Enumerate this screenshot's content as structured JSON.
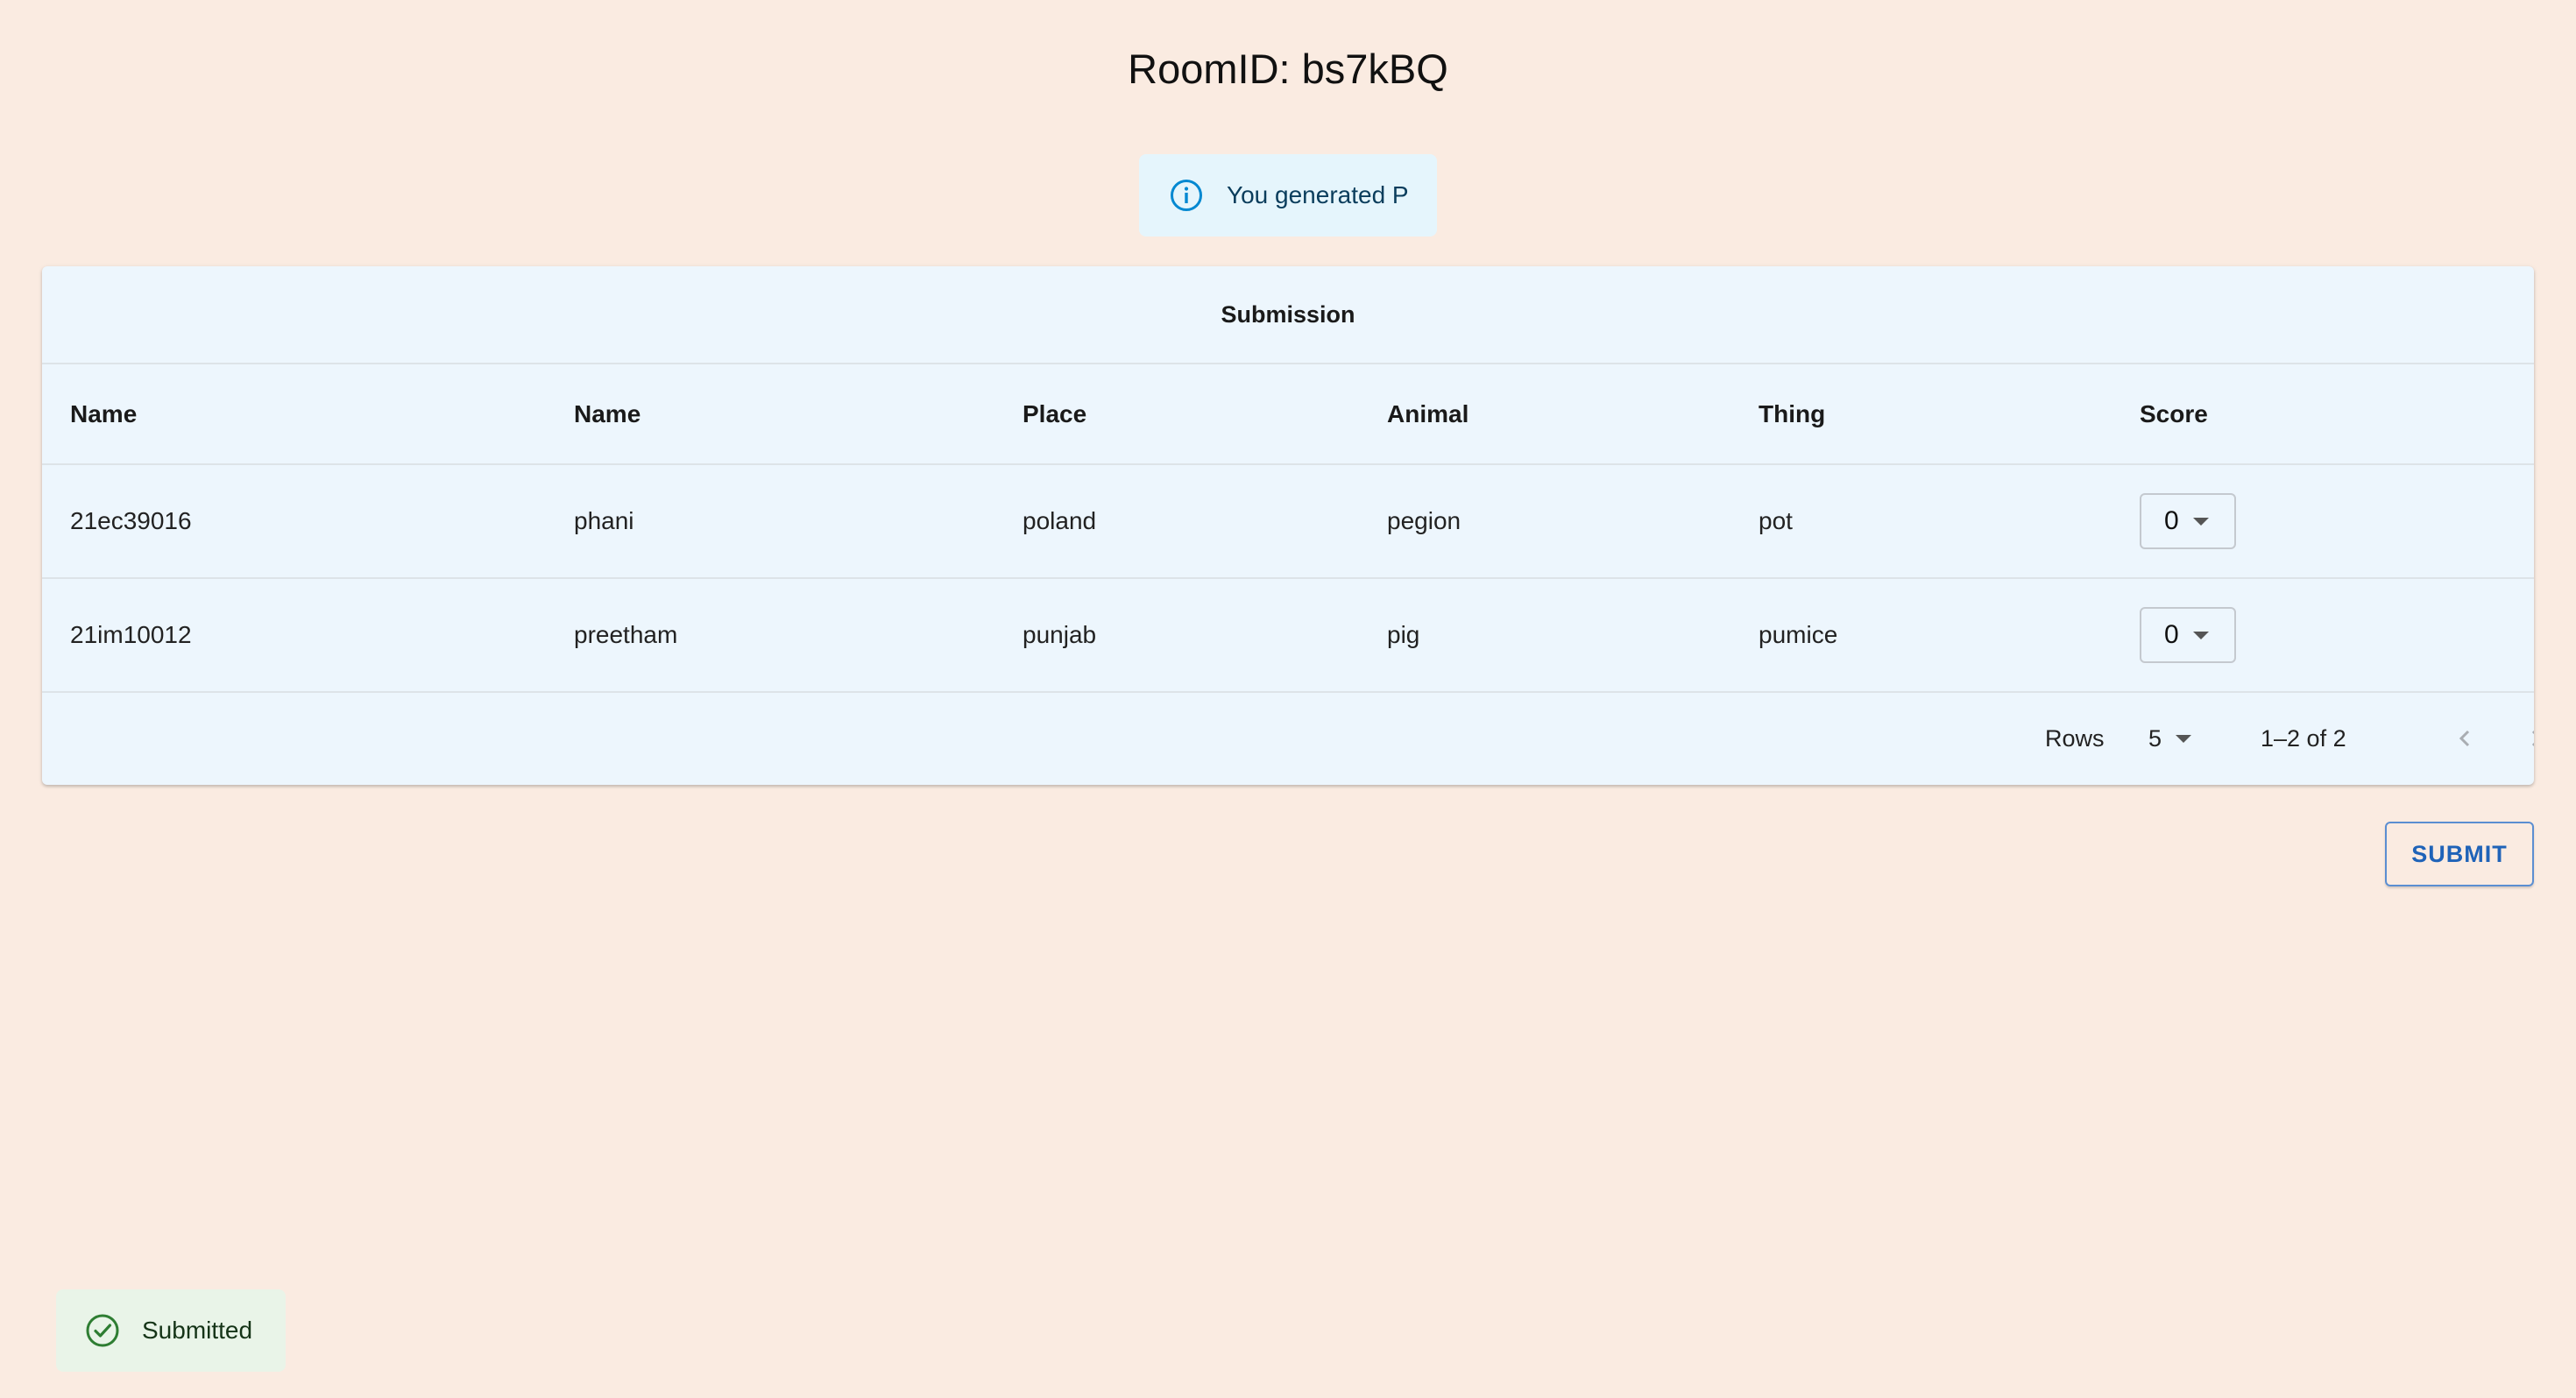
{
  "page": {
    "title": "RoomID: bs7kBQ"
  },
  "alert": {
    "icon": "info-icon",
    "message": "You generated P",
    "color": "#0288d1"
  },
  "table": {
    "header": "Submission",
    "columns": [
      "Name",
      "Name",
      "Place",
      "Animal",
      "Thing",
      "Score"
    ],
    "rows": [
      {
        "id": "21ec39016",
        "name": "phani",
        "place": "poland",
        "animal": "pegion",
        "thing": "pot",
        "score": "0"
      },
      {
        "id": "21im10012",
        "name": "preetham",
        "place": "punjab",
        "animal": "pig",
        "thing": "pumice",
        "score": "0"
      }
    ],
    "pagination": {
      "rows_label": "Rows",
      "rows_per_page": "5",
      "range": "1–2 of 2"
    }
  },
  "actions": {
    "submit_label": "SUBMIT",
    "accent": "#1f63b8"
  },
  "toast": {
    "icon": "check-circle-icon",
    "message": "Submitted",
    "color": "#2e7d32"
  }
}
